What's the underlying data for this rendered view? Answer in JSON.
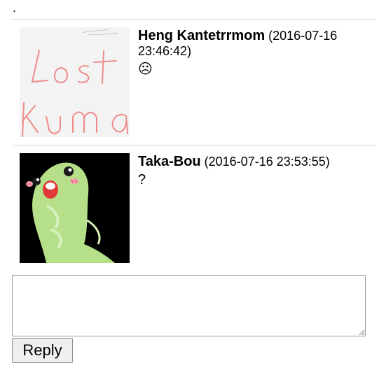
{
  "page": {
    "leading_mark": "."
  },
  "comments": [
    {
      "author": "Heng Kantetrrmom",
      "timestamp": "(2016-07-16 23:46:42)",
      "message": "☹",
      "avatar": {
        "icon": "handwriting-avatar-icon",
        "text_line1": "Lost",
        "text_line2": "kuma",
        "ink_color": "#f08a8a",
        "bg_color": "#f3f3f3"
      }
    },
    {
      "author": "Taka-Bou",
      "timestamp": "(2016-07-16 23:53:55)",
      "message": "?",
      "avatar": {
        "icon": "green-creature-avatar-icon",
        "bg_color": "#000000",
        "body_color": "#b7e08a"
      }
    }
  ],
  "reply_form": {
    "textarea_value": "",
    "button_label": "Reply"
  }
}
